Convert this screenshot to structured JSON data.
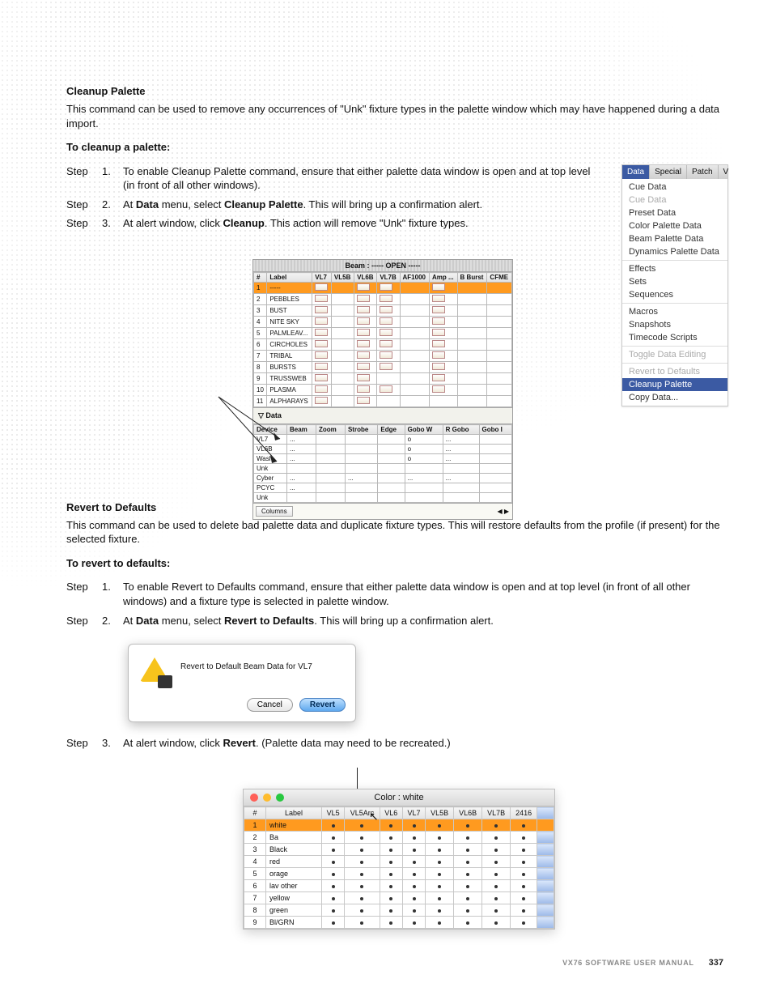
{
  "footer": {
    "title": "VX76 SOFTWARE USER MANUAL",
    "page": "337"
  },
  "s1": {
    "h": "Cleanup Palette",
    "p": "This command can be used to remove any occurrences of \"Unk\" fixture types in the palette window which may have happened during a data import.",
    "sub": "To cleanup a palette:",
    "steps": {
      "s1": "To enable Cleanup Palette command, ensure that either palette data window is open and at top level (in front of all other windows).",
      "s2a": "At ",
      "s2b": " menu, select ",
      "s2c": ". This will bring up a confirmation alert.",
      "s2_m1": "Data",
      "s2_m2": "Cleanup Palette",
      "s3a": "At alert window, click ",
      "s3b": ". This action will remove \"Unk\" fixture types.",
      "s3_m": "Cleanup"
    }
  },
  "menu": {
    "tabs": [
      "Data",
      "Special",
      "Patch",
      "V"
    ],
    "g1": [
      "Cue Data",
      "Cue Data",
      "Preset Data",
      "Color Palette Data",
      "Beam Palette Data",
      "Dynamics Palette Data"
    ],
    "g2": [
      "Effects",
      "Sets",
      "Sequences"
    ],
    "g3": [
      "Macros",
      "Snapshots",
      "Timecode Scripts"
    ],
    "g4": [
      "Toggle Data Editing"
    ],
    "g5": [
      "Revert to Defaults",
      "Cleanup Palette",
      "Copy Data..."
    ]
  },
  "beam": {
    "title": "Beam : ----- OPEN -----",
    "cols": [
      "#",
      "Label",
      "VL7",
      "VL5B",
      "VL6B",
      "VL7B",
      "AF1000",
      "Amp ...",
      "B Burst",
      "CFME"
    ],
    "rows": [
      {
        "n": "1",
        "label": "-----",
        "c": [
          1,
          0,
          1,
          1,
          0,
          1,
          0,
          0
        ]
      },
      {
        "n": "2",
        "label": "PEBBLES",
        "c": [
          1,
          0,
          1,
          1,
          0,
          1,
          0,
          0
        ]
      },
      {
        "n": "3",
        "label": "BUST",
        "c": [
          1,
          0,
          1,
          1,
          0,
          1,
          0,
          0
        ]
      },
      {
        "n": "4",
        "label": "NITE SKY",
        "c": [
          1,
          0,
          1,
          1,
          0,
          1,
          0,
          0
        ]
      },
      {
        "n": "5",
        "label": "PALMLEAV...",
        "c": [
          1,
          0,
          1,
          1,
          0,
          1,
          0,
          0
        ]
      },
      {
        "n": "6",
        "label": "CIRCHOLES",
        "c": [
          1,
          0,
          1,
          1,
          0,
          1,
          0,
          0
        ]
      },
      {
        "n": "7",
        "label": "TRIBAL",
        "c": [
          1,
          0,
          1,
          1,
          0,
          1,
          0,
          0
        ]
      },
      {
        "n": "8",
        "label": "BURSTS",
        "c": [
          1,
          0,
          1,
          1,
          0,
          1,
          0,
          0
        ]
      },
      {
        "n": "9",
        "label": "TRUSSWEB",
        "c": [
          1,
          0,
          1,
          0,
          0,
          1,
          0,
          0
        ]
      },
      {
        "n": "10",
        "label": "PLASMA",
        "c": [
          1,
          0,
          1,
          1,
          0,
          1,
          0,
          0
        ]
      },
      {
        "n": "11",
        "label": "ALPHARAYS",
        "c": [
          1,
          0,
          1,
          0,
          0,
          0,
          0,
          0
        ]
      }
    ],
    "sect": "Data",
    "cols2": [
      "Device",
      "Beam",
      "Zoom",
      "Strobe",
      "Edge",
      "Gobo W",
      "R Gobo",
      "Gobo I"
    ],
    "rows2": [
      {
        "d": "VL7",
        "v": [
          "...",
          "",
          "",
          "",
          "o",
          "...",
          ""
        ]
      },
      {
        "d": "VL6B",
        "v": [
          "...",
          "",
          "",
          "",
          "o",
          "...",
          ""
        ]
      },
      {
        "d": "Wash",
        "v": [
          "...",
          "",
          "",
          "",
          "o",
          "...",
          ""
        ]
      },
      {
        "d": "Unk",
        "v": [
          "",
          "",
          "",
          "",
          "",
          "",
          ""
        ]
      },
      {
        "d": "Cyber",
        "v": [
          "...",
          "",
          "...",
          "",
          "...",
          "...",
          ""
        ]
      },
      {
        "d": "PCYC",
        "v": [
          "...",
          "",
          "",
          "",
          "",
          "",
          ""
        ]
      },
      {
        "d": "Unk",
        "v": [
          "",
          "",
          "",
          "",
          "",
          "",
          ""
        ]
      }
    ],
    "colbtn": "Columns"
  },
  "s2": {
    "h": "Revert to Defaults",
    "p": "This command can be used to delete bad palette data and duplicate fixture types. This will restore defaults from the profile (if present) for the selected fixture.",
    "sub": "To revert to defaults:",
    "steps": {
      "s1": "To enable Revert to Defaults command, ensure that either palette data window is open and at top level (in front of all other windows) and a fixture type is selected in palette window.",
      "s2a": "At ",
      "s2b": " menu, select ",
      "s2c": ". This will bring up a confirmation alert.",
      "s2_m1": "Data",
      "s2_m2": "Revert to Defaults",
      "s3a": "At alert window, click ",
      "s3b": ". (Palette data may need to be recreated.)",
      "s3_m": "Revert"
    }
  },
  "dlg": {
    "msg": "Revert to Default Beam Data for VL7",
    "cancel": "Cancel",
    "ok": "Revert"
  },
  "color": {
    "title": "Color : white",
    "cols": [
      "#",
      "Label",
      "VL5",
      "VL5Arc",
      "VL6",
      "VL7",
      "VL5B",
      "VL6B",
      "VL7B",
      "2416"
    ],
    "rows": [
      {
        "n": "1",
        "l": "white"
      },
      {
        "n": "2",
        "l": "Ba"
      },
      {
        "n": "3",
        "l": "Black"
      },
      {
        "n": "4",
        "l": "red"
      },
      {
        "n": "5",
        "l": "orage"
      },
      {
        "n": "6",
        "l": "lav other"
      },
      {
        "n": "7",
        "l": "yellow"
      },
      {
        "n": "8",
        "l": "green"
      },
      {
        "n": "9",
        "l": "Bl/GRN"
      }
    ]
  },
  "steplabel": "Step"
}
